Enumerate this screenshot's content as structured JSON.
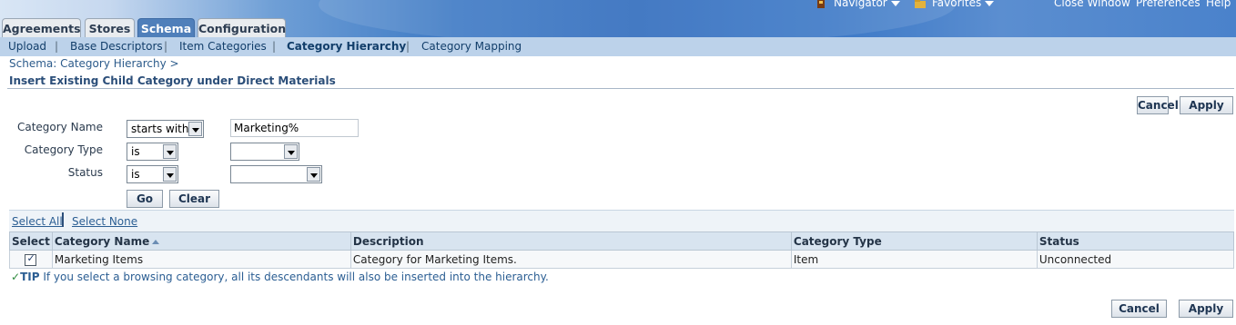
{
  "global_nav": {
    "navigator": "Navigator",
    "favorites": "Favorites",
    "close_window": "Close Window",
    "preferences": "Preferences",
    "help": "Help"
  },
  "tabs": [
    "Agreements",
    "Stores",
    "Schema",
    "Configuration"
  ],
  "active_tab": "Schema",
  "subnav": {
    "items": [
      "Upload",
      "Base Descriptors",
      "Item Categories",
      "Category Hierarchy",
      "Category Mapping"
    ],
    "current": "Category Hierarchy"
  },
  "breadcrumb": "Schema: Category Hierarchy  >",
  "page_title": "Insert Existing Child Category under Direct Materials",
  "buttons": {
    "cancel": "Cancel",
    "apply": "Apply",
    "go": "Go",
    "clear": "Clear"
  },
  "search": {
    "category_name_label": "Category Name",
    "category_name_operator": "starts with",
    "category_name_value": "Marketing%",
    "category_type_label": "Category Type",
    "category_type_operator": "is",
    "category_type_value": "",
    "status_label": "Status",
    "status_operator": "is",
    "status_value": ""
  },
  "selection": {
    "select_all": "Select All",
    "select_none": "Select None"
  },
  "table": {
    "columns": [
      "Select",
      "Category Name",
      "Description",
      "Category Type",
      "Status"
    ],
    "rows": [
      {
        "selected": true,
        "name": "Marketing Items",
        "description": "Category for Marketing Items.",
        "type": "Item",
        "status": "Unconnected"
      }
    ]
  },
  "tip": {
    "label": "TIP",
    "text": " If you select a browsing category, all its descendants will also be inserted into the hierarchy."
  },
  "colors": {
    "accent": "#4f7fba",
    "subnav": "#bcd2ea",
    "header_dark": "#2f6bbd"
  }
}
